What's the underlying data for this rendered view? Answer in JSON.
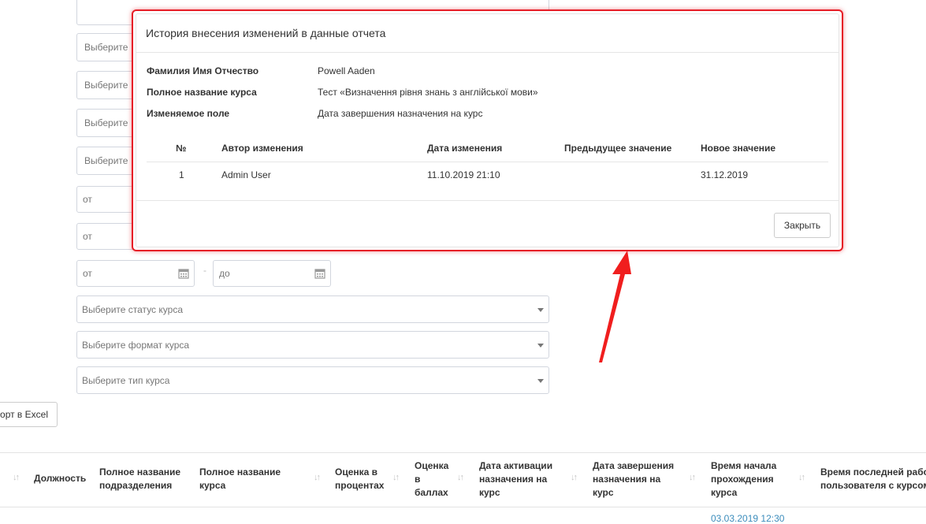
{
  "filters": {
    "select_placeholder_prefix": "Выберите",
    "range_from": "от",
    "range_to": "до",
    "range_dash": "-",
    "course_status_placeholder": "Выберите статус курса",
    "course_format_placeholder": "Выберите формат курса",
    "course_type_placeholder": "Выберите тип курса"
  },
  "export_button_label": "орт в Excel",
  "table": {
    "columns": [
      "Должность",
      "Полное название подразделения",
      "Полное название курса",
      "Оценка в процентах",
      "Оценка в баллах",
      "Дата активации назначения на курс",
      "Дата завершения назначения на курс",
      "Время начала прохождения курса",
      "Время последней работы пользователя с курсом"
    ],
    "col_display": {
      "c0": "Должность",
      "c1a": "Полное название",
      "c1b": "подразделения",
      "c2a": "Полное название",
      "c2b": "курса",
      "c3a": "Оценка в",
      "c3b": "процентах",
      "c4a": "Оценка",
      "c4b": "в",
      "c4c": "баллах",
      "c5a": "Дата активации",
      "c5b": "назначения на",
      "c5c": "курс",
      "c6a": "Дата завершения",
      "c6b": "назначения на",
      "c6c": "курс",
      "c7a": "Время начала",
      "c7b": "прохождения",
      "c7c": "курса",
      "c8a": "Время последней рабо",
      "c8b": "пользователя с курсом"
    },
    "partial_row_value": "03.03.2019 12:30"
  },
  "modal": {
    "title": "История внесения изменений в данные отчета",
    "fields": [
      {
        "label": "Фамилия Имя Отчество",
        "value": "Powell Aaden"
      },
      {
        "label": "Полное название курса",
        "value": "Тест «Визначення рівня знань з англійської мови»"
      },
      {
        "label": "Изменяемое поле",
        "value": "Дата завершения назначения на курс"
      }
    ],
    "history_columns": [
      "№",
      "Автор изменения",
      "Дата изменения",
      "Предыдущее значение",
      "Новое значение"
    ],
    "history_rows": [
      {
        "num": "1",
        "author": "Admin User",
        "date": "11.10.2019 21:10",
        "previous": "",
        "new": "31.12.2019"
      }
    ],
    "close_label": "Закрыть"
  },
  "colors": {
    "highlight_red": "#e61e27",
    "partial_row_link": "#3c8dbc"
  }
}
